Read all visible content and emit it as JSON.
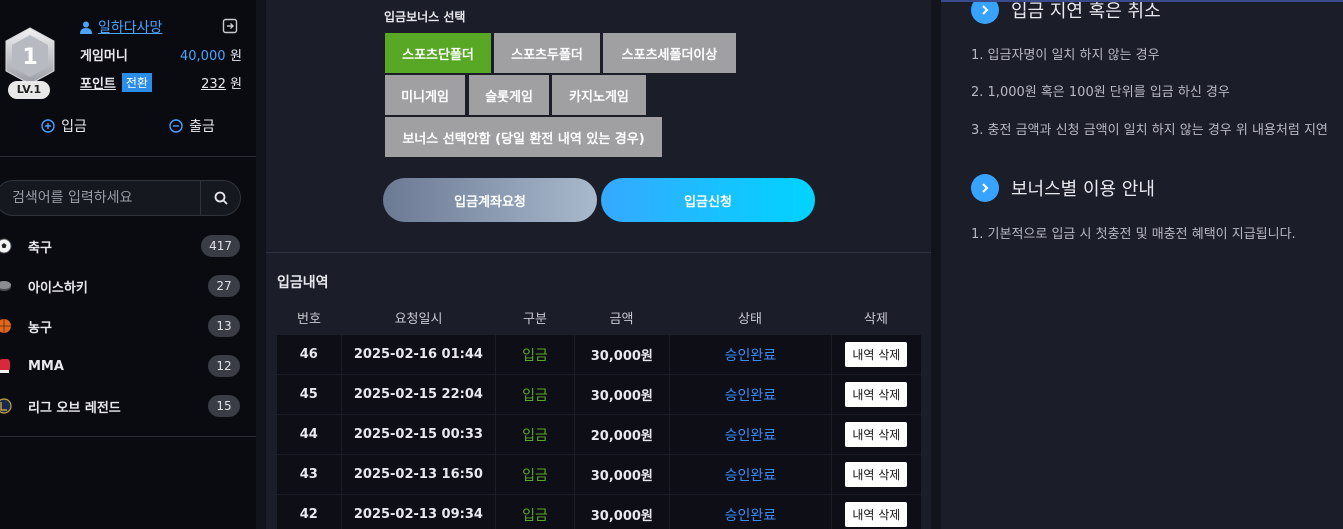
{
  "profile": {
    "level_number": "1",
    "level_label": "LV.1",
    "username": "일하다사망",
    "game_money_label": "게임머니",
    "game_money_value": "40,000",
    "currency": "원",
    "point_label": "포인트",
    "convert_label": "전환",
    "point_value": "232",
    "deposit_label": "입금",
    "withdraw_label": "출금"
  },
  "search": {
    "placeholder": "검색어를 입력하세요"
  },
  "sports": [
    {
      "name": "축구",
      "count": "417",
      "icon": "soccer-ball-icon"
    },
    {
      "name": "아이스하키",
      "count": "27",
      "icon": "hockey-puck-icon"
    },
    {
      "name": "농구",
      "count": "13",
      "icon": "basketball-icon"
    },
    {
      "name": "MMA",
      "count": "12",
      "icon": "boxing-glove-icon"
    },
    {
      "name": "리그 오브 레전드",
      "count": "15",
      "icon": "lol-icon"
    }
  ],
  "bonus": {
    "title": "입금보너스 선택",
    "options": [
      "스포츠단폴더",
      "스포츠두폴더",
      "스포츠세폴더이상",
      "미니게임",
      "슬롯게임",
      "카지노게임",
      "보너스 선택안함 (당일 환전 내역 있는 경우)"
    ],
    "selected": "스포츠단폴더"
  },
  "actions": {
    "account_request": "입금계좌요청",
    "deposit_apply": "입금신청"
  },
  "history": {
    "title": "입금내역",
    "columns": [
      "번호",
      "요청일시",
      "구분",
      "금액",
      "상태",
      "삭제"
    ],
    "rows": [
      {
        "no": "46",
        "date": "2025-02-16 01:44",
        "type": "입금",
        "amount": "30,000원",
        "status": "승인완료",
        "delete": "내역 삭제"
      },
      {
        "no": "45",
        "date": "2025-02-15 22:04",
        "type": "입금",
        "amount": "30,000원",
        "status": "승인완료",
        "delete": "내역 삭제"
      },
      {
        "no": "44",
        "date": "2025-02-15 00:33",
        "type": "입금",
        "amount": "20,000원",
        "status": "승인완료",
        "delete": "내역 삭제"
      },
      {
        "no": "43",
        "date": "2025-02-13 16:50",
        "type": "입금",
        "amount": "30,000원",
        "status": "승인완료",
        "delete": "내역 삭제"
      },
      {
        "no": "42",
        "date": "2025-02-13 09:34",
        "type": "입금",
        "amount": "30,000원",
        "status": "승인완료",
        "delete": "내역 삭제"
      }
    ]
  },
  "notice": {
    "delay_title": "입금 지연 혹은 취소",
    "delay_items": [
      "1. 입금자명이 일치 하지 않는 경우",
      "2. 1,000원 혹은 100원 단위를 입금 하신 경우",
      "3. 충전 금액과 신청 금액이 일치 하지 않는 경우 위 내용처럼 지연"
    ],
    "bonus_title": "보너스별 이용 안내",
    "bonus_items": [
      "1. 기본적으로 입금 시 첫충전 및 매충전 혜택이 지급됩니다."
    ]
  },
  "colors": {
    "accent_blue": "#38a2ff",
    "selected_green": "#58a825",
    "status_blue": "#3a8cff"
  }
}
